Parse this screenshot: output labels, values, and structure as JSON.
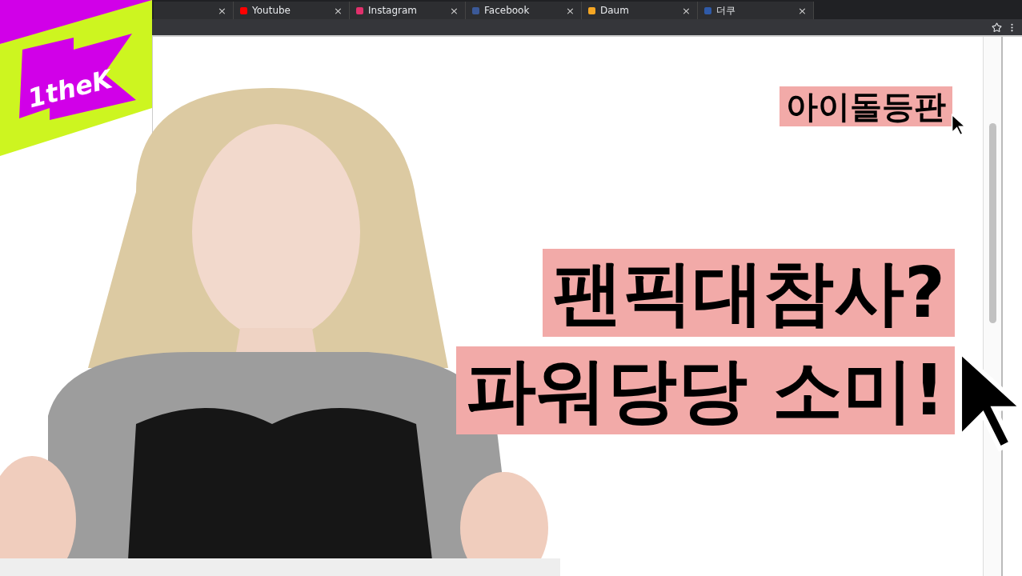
{
  "logo": {
    "text": "1theK"
  },
  "partial_tab": {
    "close": "×"
  },
  "tabs": [
    {
      "label": "Youtube",
      "close": "×",
      "color": "#ff0000"
    },
    {
      "label": "Instagram",
      "close": "×",
      "color": "#e1306c"
    },
    {
      "label": "Facebook",
      "close": "×",
      "color": "#3b5998"
    },
    {
      "label": "Daum",
      "close": "×",
      "color": "#f5a623"
    },
    {
      "label": "더쿠",
      "close": "×",
      "color": "#2f5aa8"
    }
  ],
  "captions": [
    {
      "text": "아이돌등판",
      "kind": "tag"
    },
    {
      "text": "팬픽대참사?",
      "kind": "headline"
    },
    {
      "text": "파워당당 소미!",
      "kind": "headline"
    }
  ]
}
